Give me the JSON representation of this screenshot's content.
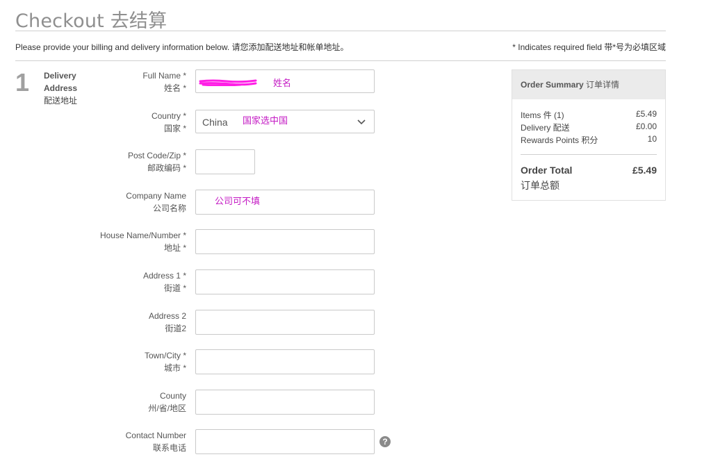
{
  "header": {
    "title": "Checkout 去结算",
    "intro": "Please provide your billing and delivery information below. 请您添加配送地址和帐单地址。",
    "required_note": "* Indicates required field 带*号为必填区域"
  },
  "step": {
    "number": "1",
    "title_en_1": "Delivery",
    "title_en_2": "Address",
    "title_zh": "配送地址"
  },
  "form": {
    "full_name": {
      "label_en": "Full Name *",
      "label_zh": "姓名 *",
      "annotation": "姓名"
    },
    "country": {
      "label_en": "Country *",
      "label_zh": "国家 *",
      "value": "China",
      "annotation": "国家选中国"
    },
    "post_code": {
      "label_en": "Post Code/Zip *",
      "label_zh": "邮政编码 *"
    },
    "company": {
      "label_en": "Company Name",
      "label_zh": "公司名称",
      "annotation": "公司可不填"
    },
    "house": {
      "label_en": "House Name/Number *",
      "label_zh": "地址 *"
    },
    "address1": {
      "label_en": "Address 1 *",
      "label_zh": "街道 *"
    },
    "address2": {
      "label_en": "Address 2",
      "label_zh": "街道2"
    },
    "town": {
      "label_en": "Town/City *",
      "label_zh": "城市 *"
    },
    "county": {
      "label_en": "County",
      "label_zh": "州/省/地区"
    },
    "contact": {
      "label_en": "Contact Number",
      "label_zh": "联系电话",
      "help_icon": "?"
    }
  },
  "summary": {
    "title_en": "Order Summary",
    "title_zh": "订单详情",
    "items_label": "Items 件 (1)",
    "items_amount": "£5.49",
    "delivery_label": "Delivery 配送",
    "delivery_amount": "£0.00",
    "rewards_label": "Rewards Points 积分",
    "rewards_amount": "10",
    "total_label": "Order Total",
    "total_amount": "£5.49",
    "total_label_zh": "订单总额"
  },
  "colors": {
    "annotation": "#c41ac4",
    "scribble": "#ff1ee6"
  }
}
